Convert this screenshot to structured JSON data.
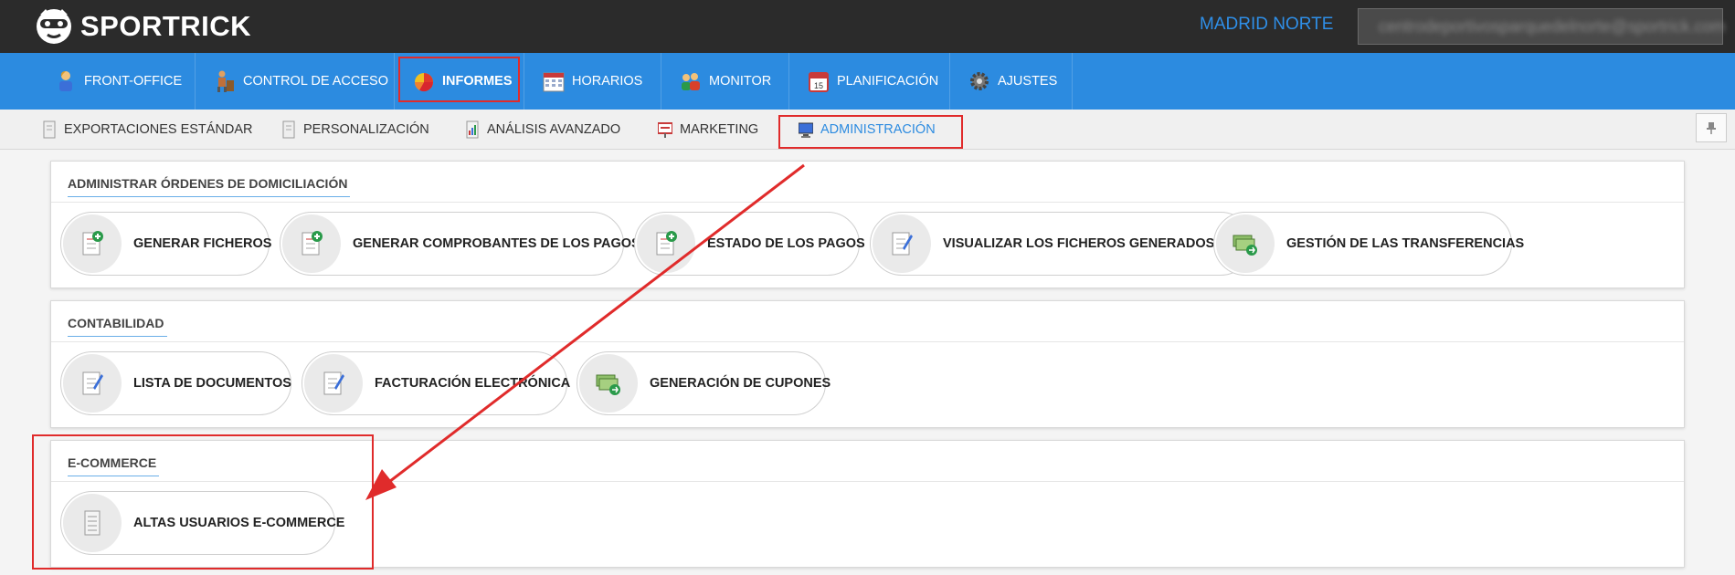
{
  "brand": {
    "name": "SPORTRICK",
    "icon": "goggles-face-logo-icon"
  },
  "header": {
    "center_name": "MADRID NORTE",
    "user_email": "centrodeportivosparquedelnorte@sportrick.com"
  },
  "main_nav": [
    {
      "label": "FRONT-OFFICE",
      "icon": "person-icon"
    },
    {
      "label": "CONTROL DE ACCESO",
      "icon": "turnstile-person-icon"
    },
    {
      "label": "INFORMES",
      "icon": "pie-chart-icon",
      "active": true
    },
    {
      "label": "HORARIOS",
      "icon": "calendar-grid-icon"
    },
    {
      "label": "MONITOR",
      "icon": "people-group-icon"
    },
    {
      "label": "PLANIFICACIÓN",
      "icon": "calendar-15-icon"
    },
    {
      "label": "AJUSTES",
      "icon": "gear-icon"
    }
  ],
  "sub_nav": [
    {
      "label": "EXPORTACIONES ESTÁNDAR",
      "icon": "document-icon"
    },
    {
      "label": "PERSONALIZACIÓN",
      "icon": "document-icon"
    },
    {
      "label": "ANÁLISIS AVANZADO",
      "icon": "report-icon"
    },
    {
      "label": "MARKETING",
      "icon": "presentation-icon"
    },
    {
      "label": "ADMINISTRACIÓN",
      "icon": "monitor-icon",
      "active": true
    }
  ],
  "sections": [
    {
      "title": "ADMINISTRAR ÓRDENES DE DOMICILIACIÓN",
      "buttons": [
        {
          "label": "GENERAR FICHEROS",
          "icon": "file-add-icon"
        },
        {
          "label": "GENERAR COMPROBANTES DE LOS PAGOS",
          "icon": "file-add-icon"
        },
        {
          "label": "ESTADO DE LOS PAGOS",
          "icon": "file-add-icon"
        },
        {
          "label": "VISUALIZAR LOS FICHEROS GENERADOS",
          "icon": "file-edit-icon"
        },
        {
          "label": "GESTIÓN DE LAS TRANSFERENCIAS",
          "icon": "money-transfer-icon"
        }
      ]
    },
    {
      "title": "CONTABILIDAD",
      "buttons": [
        {
          "label": "LISTA DE DOCUMENTOS",
          "icon": "file-edit-icon"
        },
        {
          "label": "FACTURACIÓN ELECTRÓNICA",
          "icon": "file-edit-icon"
        },
        {
          "label": "GENERACIÓN DE CUPONES",
          "icon": "money-transfer-icon"
        }
      ]
    },
    {
      "title": "E-COMMERCE",
      "buttons": [
        {
          "label": "ALTAS USUARIOS E-COMMERCE",
          "icon": "list-document-icon"
        }
      ]
    }
  ],
  "annotation": {
    "highlight_color": "#e02b2b",
    "arrow": "from ADMINISTRACIÓN tab to E-COMMERCE section"
  },
  "colors": {
    "topbar": "#2b2b2b",
    "nav_blue": "#2c8be0",
    "accent_text": "#2f8fe8",
    "highlight": "#e02b2b"
  }
}
